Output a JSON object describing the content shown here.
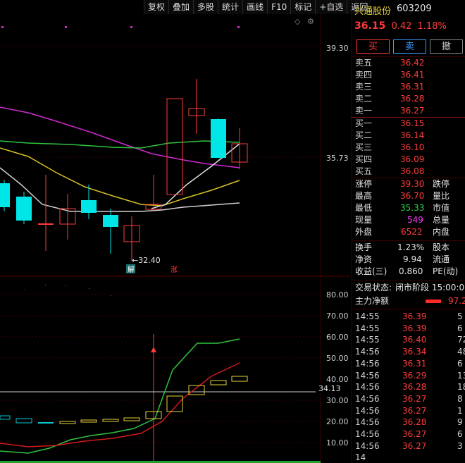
{
  "toolbar": {
    "items": [
      "复权",
      "叠加",
      "多股",
      "统计",
      "画线",
      "F10",
      "标记",
      "+自选",
      "返回"
    ]
  },
  "chart": {
    "price_axis": [
      "39.30",
      "35.73"
    ],
    "low_marker": "←32.40",
    "badge_jie": "解",
    "badge_zhang": "涨",
    "ind_axis": [
      "80.00",
      "70.00",
      "60.00",
      "50.00",
      "40.00",
      "30.00",
      "20.00",
      "10.00"
    ],
    "crosshair_value": "34.13",
    "diamond_icon": "◇",
    "settings_icon": "⚙"
  },
  "stock": {
    "name": "兴通股份",
    "code": "603209",
    "price": "36.15",
    "change": "0.42",
    "change_pct": "1.18%"
  },
  "trade_buttons": {
    "buy": "买",
    "sell": "卖",
    "cancel": "撤"
  },
  "sells": [
    {
      "label": "卖五",
      "price": "36.42"
    },
    {
      "label": "卖四",
      "price": "36.41"
    },
    {
      "label": "卖三",
      "price": "36.31"
    },
    {
      "label": "卖二",
      "price": "36.28"
    },
    {
      "label": "卖一",
      "price": "36.27"
    }
  ],
  "buys": [
    {
      "label": "买一",
      "price": "36.15"
    },
    {
      "label": "买二",
      "price": "36.14"
    },
    {
      "label": "买三",
      "price": "36.10"
    },
    {
      "label": "买四",
      "price": "36.09"
    },
    {
      "label": "买五",
      "price": "36.08"
    }
  ],
  "stats": {
    "zt_label": "涨停",
    "zt": "39.30",
    "dt_label": "跌停",
    "high_label": "最高",
    "high": "36.70",
    "lb_label": "量比",
    "low_label": "最低",
    "low": "35.33",
    "sz_label": "市值",
    "xl_label": "现量",
    "xl": "549",
    "zl_label": "总量",
    "wp_label": "外盘",
    "wp": "6522",
    "np_label": "内盘",
    "hs_label": "换手",
    "hs": "1.23%",
    "gb_label": "股本",
    "jz_label": "净资",
    "jz": "9.94",
    "lt_label": "流通",
    "sy_label": "收益(三)",
    "sy": "0.860",
    "pe_label": "PE(动)"
  },
  "status": {
    "label": "交易状态:",
    "value": "闭市阶段 15:00:0",
    "net_label": "主力净额",
    "net_value": "97.2"
  },
  "ticks": [
    {
      "t": "14:55",
      "p": "36.39",
      "v": "5"
    },
    {
      "t": "14:55",
      "p": "36.39",
      "v": "6"
    },
    {
      "t": "14:55",
      "p": "36.40",
      "v": "72"
    },
    {
      "t": "14:56",
      "p": "36.34",
      "v": "48"
    },
    {
      "t": "14:56",
      "p": "36.31",
      "v": "6"
    },
    {
      "t": "14:56",
      "p": "36.29",
      "v": "13"
    },
    {
      "t": "14:56",
      "p": "36.28",
      "v": "18"
    },
    {
      "t": "14:56",
      "p": "36.27",
      "v": "8"
    },
    {
      "t": "14:56",
      "p": "36.27",
      "v": "1"
    },
    {
      "t": "14:56",
      "p": "36.28",
      "v": "9"
    },
    {
      "t": "14:56",
      "p": "36.27",
      "v": "6"
    },
    {
      "t": "14:56",
      "p": "36.27",
      "v": "3"
    },
    {
      "t": "14",
      "p": "",
      "v": ""
    }
  ]
}
